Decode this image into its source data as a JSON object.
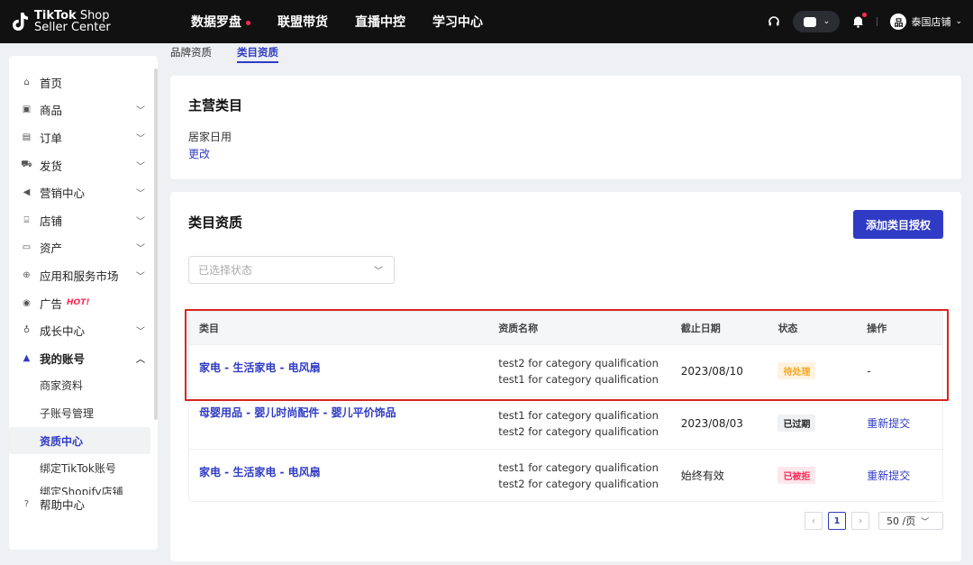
{
  "header": {
    "logo_line1_bold": "TikTok",
    "logo_line1_rest": " Shop",
    "logo_line2": "Seller Center",
    "nav": [
      "数据罗盘",
      "联盟带货",
      "直播中控",
      "学习中心"
    ],
    "shop_label": "泰国店铺"
  },
  "tabs": [
    "品牌资质",
    "类目资质"
  ],
  "sidebar": {
    "items": [
      {
        "label": "首页",
        "icon": "home-icon"
      },
      {
        "label": "商品",
        "icon": "product-icon"
      },
      {
        "label": "订单",
        "icon": "order-icon"
      },
      {
        "label": "发货",
        "icon": "truck-icon"
      },
      {
        "label": "营销中心",
        "icon": "megaphone-icon"
      },
      {
        "label": "店铺",
        "icon": "store-icon"
      },
      {
        "label": "资产",
        "icon": "card-icon"
      },
      {
        "label": "应用和服务市场",
        "icon": "globe-icon"
      },
      {
        "label": "广告",
        "icon": "ad-icon",
        "badge": "HOT!"
      },
      {
        "label": "成长中心",
        "icon": "medal-icon"
      },
      {
        "label": "我的账号",
        "icon": "user-icon"
      }
    ],
    "sub_items": [
      "商家资料",
      "子账号管理",
      "资质中心",
      "绑定TikTok账号",
      "绑定Shopify店铺"
    ],
    "help": "帮助中心"
  },
  "main_category": {
    "title": "主营类目",
    "value": "居家日用",
    "change": "更改"
  },
  "qualification": {
    "title": "类目资质",
    "add_button": "添加类目授权",
    "status_placeholder": "已选择状态",
    "columns": [
      "类目",
      "资质名称",
      "截止日期",
      "状态",
      "操作"
    ],
    "rows": [
      {
        "category": "家电 - 生活家电 - 电风扇",
        "quals": [
          "test2 for category qualification",
          "test1 for category qualification"
        ],
        "deadline": "2023/08/10",
        "status": "待处理",
        "action": "-"
      },
      {
        "category": "母婴用品 - 婴儿时尚配件 - 婴儿平价饰品",
        "quals": [
          "test1 for category qualification",
          "test2 for category qualification"
        ],
        "deadline": "2023/08/03",
        "status": "已过期",
        "action": "重新提交"
      },
      {
        "category": "家电 - 生活家电 - 电风扇",
        "quals": [
          "test1 for category qualification",
          "test2 for category qualification"
        ],
        "deadline": "始终有效",
        "status": "已被拒",
        "action": "重新提交"
      }
    ],
    "pager": {
      "current": "1",
      "page_size": "50 /页"
    }
  },
  "colors": {
    "accent": "#2f3bc4",
    "brand_red": "#fe2c55",
    "highlight": "#d9261c"
  }
}
